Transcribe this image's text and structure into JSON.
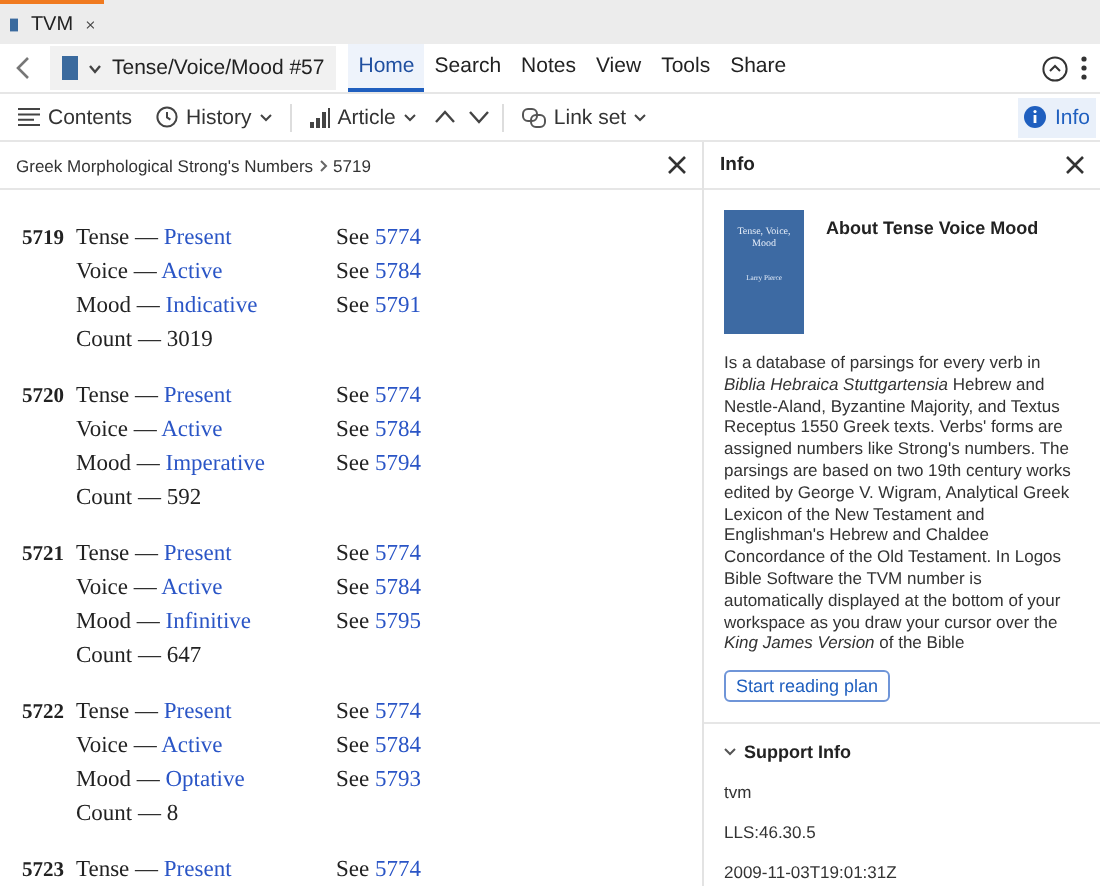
{
  "window_tab": {
    "title": "TVM"
  },
  "toolbar": {
    "resource": "Tense/Voice/Mood #57",
    "menu": [
      {
        "label": "Home",
        "selected": true
      },
      {
        "label": "Search",
        "selected": false
      },
      {
        "label": "Notes",
        "selected": false
      },
      {
        "label": "View",
        "selected": false
      },
      {
        "label": "Tools",
        "selected": false
      },
      {
        "label": "Share",
        "selected": false
      }
    ]
  },
  "panel_toolbar": {
    "contents": "Contents",
    "history": "History",
    "article": "Article",
    "link_set": "Link set",
    "info": "Info"
  },
  "breadcrumb": {
    "path": "Greek Morphological Strong's Numbers",
    "current": "5719"
  },
  "entries": [
    {
      "number": "5719",
      "lines": [
        {
          "label": "Tense —",
          "value": "Present",
          "see": "See",
          "ref": "5774"
        },
        {
          "label": "Voice —",
          "value": "Active",
          "see": "See",
          "ref": "5784"
        },
        {
          "label": "Mood —",
          "value": "Indicative",
          "see": "See",
          "ref": "5791"
        }
      ],
      "count_label": "Count —",
      "count": "3019"
    },
    {
      "number": "5720",
      "lines": [
        {
          "label": "Tense —",
          "value": "Present",
          "see": "See",
          "ref": "5774"
        },
        {
          "label": "Voice —",
          "value": "Active",
          "see": "See",
          "ref": "5784"
        },
        {
          "label": "Mood —",
          "value": "Imperative",
          "see": "See",
          "ref": "5794"
        }
      ],
      "count_label": "Count —",
      "count": "592"
    },
    {
      "number": "5721",
      "lines": [
        {
          "label": "Tense —",
          "value": "Present",
          "see": "See",
          "ref": "5774"
        },
        {
          "label": "Voice —",
          "value": "Active",
          "see": "See",
          "ref": "5784"
        },
        {
          "label": "Mood —",
          "value": "Infinitive",
          "see": "See",
          "ref": "5795"
        }
      ],
      "count_label": "Count —",
      "count": "647"
    },
    {
      "number": "5722",
      "lines": [
        {
          "label": "Tense —",
          "value": "Present",
          "see": "See",
          "ref": "5774"
        },
        {
          "label": "Voice —",
          "value": "Active",
          "see": "See",
          "ref": "5784"
        },
        {
          "label": "Mood —",
          "value": "Optative",
          "see": "See",
          "ref": "5793"
        }
      ],
      "count_label": "Count —",
      "count": "8"
    },
    {
      "number": "5723",
      "lines": [
        {
          "label": "Tense —",
          "value": "Present",
          "see": "See",
          "ref": "5774"
        }
      ]
    }
  ],
  "info_panel": {
    "title": "Info",
    "cover": {
      "title": "Tense, Voice, Mood",
      "author": "Larry Pierce"
    },
    "heading": "About Tense Voice Mood",
    "description": "Is a database of parsings for every verb in *Biblia Hebraica Stuttgartensia* Hebrew and Nestle-Aland, Byzantine Majority, and Textus Receptus 1550 Greek texts. Verbs' forms are assigned numbers like Strong's numbers. The parsings are based on two 19th century works edited by George V. Wigram, Analytical Greek Lexicon of the New Testament and Englishman's Hebrew and Chaldee Concordance of the Old Testament. In Logos Bible Software the TVM number is automatically displayed at the bottom of your workspace as you draw your cursor over the *King James Version* of the Bible",
    "button": "Start reading plan",
    "support": {
      "title": "Support Info",
      "expanded": true,
      "items": [
        "tvm",
        "LLS:46.30.5",
        "2009-11-03T19:01:31Z"
      ]
    }
  }
}
